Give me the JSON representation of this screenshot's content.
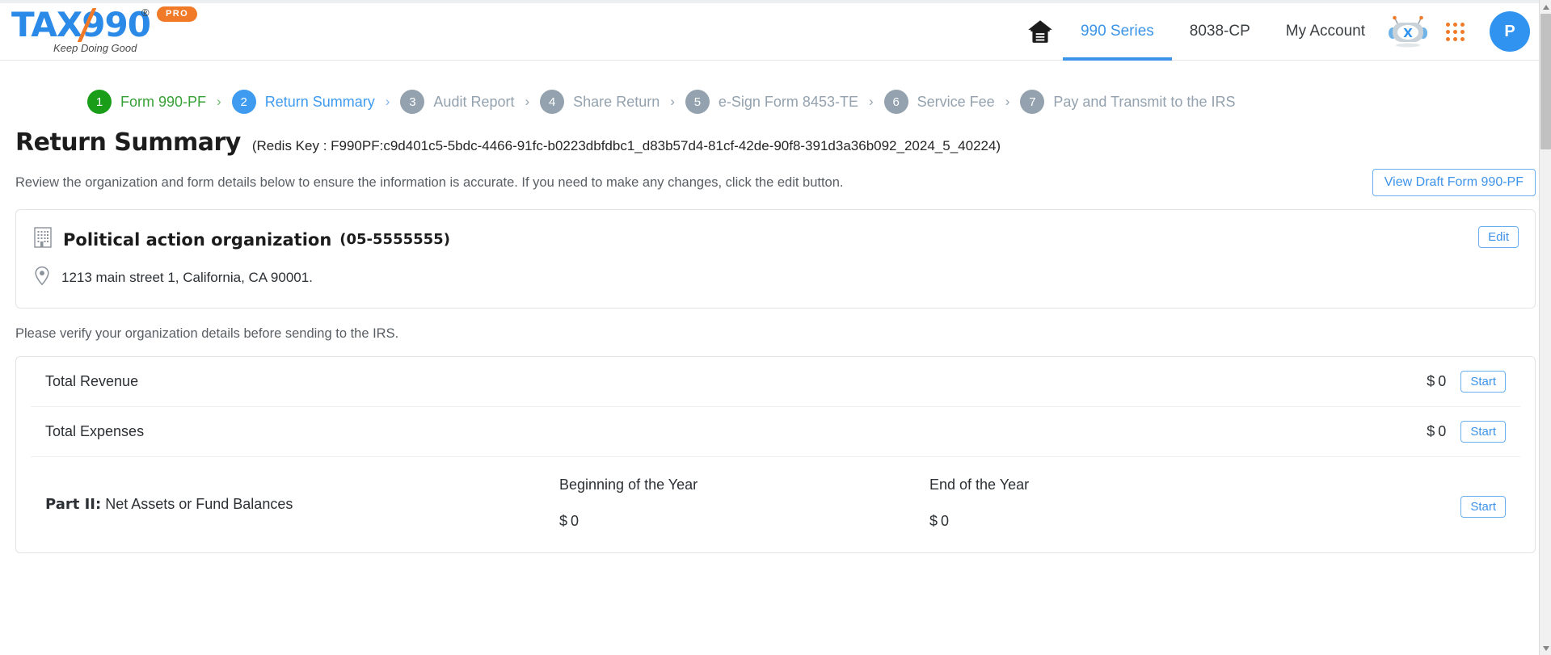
{
  "header": {
    "logo": {
      "text_tax": "TA",
      "text_x": "X",
      "text_990": "990",
      "registered": "®",
      "pro_badge": "PRO",
      "tagline": "Keep Doing Good"
    },
    "home_icon": "home-icon",
    "nav": [
      {
        "label": "990 Series",
        "active": true
      },
      {
        "label": "8038-CP",
        "active": false
      },
      {
        "label": "My Account",
        "active": false
      }
    ],
    "bot_icon": "chat-bot-icon",
    "apps_icon": "apps-grid-icon",
    "avatar_initial": "P",
    "accent_blue": "#3b94e8",
    "accent_orange": "#f07a28"
  },
  "stepper": {
    "steps": [
      {
        "num": "1",
        "label": "Form 990-PF",
        "state": "done"
      },
      {
        "num": "2",
        "label": "Return Summary",
        "state": "current"
      },
      {
        "num": "3",
        "label": "Audit Report",
        "state": "todo"
      },
      {
        "num": "4",
        "label": "Share Return",
        "state": "todo"
      },
      {
        "num": "5",
        "label": "e-Sign Form 8453-TE",
        "state": "todo"
      },
      {
        "num": "6",
        "label": "Service Fee",
        "state": "todo"
      },
      {
        "num": "7",
        "label": "Pay and Transmit to the IRS",
        "state": "todo"
      }
    ],
    "separator": "›",
    "colors": {
      "done": "#1a9e1a",
      "current": "#3e9bf0",
      "todo": "#93a2ae"
    }
  },
  "main": {
    "page_title": "Return Summary",
    "redis_key": "(Redis Key : F990PF:c9d401c5-5bdc-4466-91fc-b0223dbfdbc1_d83b57d4-81cf-42de-90f8-391d3a36b092_2024_5_40224)",
    "intro_text": "Review the organization and form details below to ensure the information is accurate. If you need to make any changes, click the edit button.",
    "view_draft_button": "View Draft Form 990-PF",
    "organization": {
      "building_icon": "building-icon",
      "name": "Political action organization",
      "ein": "(05-5555555)",
      "location_icon": "location-pin-icon",
      "address": "1213 main street 1, California, CA 90001.",
      "edit_button": "Edit"
    },
    "verify_note": "Please verify your organization details before sending to the IRS.",
    "summary_rows": [
      {
        "label": "Total Revenue",
        "currency": "$",
        "amount": "0",
        "action": "Start"
      },
      {
        "label": "Total Expenses",
        "currency": "$",
        "amount": "0",
        "action": "Start"
      }
    ],
    "part_row": {
      "part_prefix": "Part II:",
      "part_title": "Net Assets or Fund Balances",
      "col_begin_label": "Beginning of the Year",
      "col_begin_currency": "$",
      "col_begin_value": "0",
      "col_end_label": "End of the Year",
      "col_end_currency": "$",
      "col_end_value": "0",
      "action": "Start"
    }
  },
  "scrollbar": {
    "up_arrow": "scroll-up-arrow",
    "down_arrow": "scroll-down-arrow"
  }
}
